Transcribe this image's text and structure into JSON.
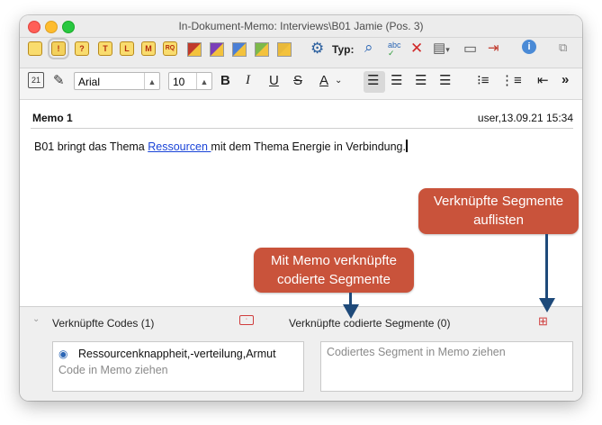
{
  "window": {
    "title": "In-Dokument-Memo: Interviews\\B01 Jamie (Pos. 3)"
  },
  "toolbar": {
    "memo_icons": [
      "",
      "!",
      "?",
      "T",
      "L",
      "M",
      "RQ"
    ],
    "type_label": "Typ:",
    "icons": [
      "search-icon",
      "spellcheck-icon",
      "delete-icon",
      "export-icon",
      "print-icon",
      "exit-icon",
      "info-icon",
      "window-icon"
    ]
  },
  "format_toolbar": {
    "font": "Arial",
    "size": "10",
    "buttons": [
      "B",
      "I",
      "U",
      "S",
      "A"
    ]
  },
  "memo": {
    "title": "Memo 1",
    "meta": "user,13.09.21 15:34",
    "text_before": "B01 bringt das Thema ",
    "link": "Ressourcen ",
    "text_after": "mit dem Thema Energie in Verbindung."
  },
  "linked_codes": {
    "label": "Verknüpfte Codes (1)",
    "item": "Ressourcenknappheit,-verteilung,Armut",
    "placeholder": "Code in Memo ziehen"
  },
  "linked_segments": {
    "label": "Verknüpfte codierte Segmente (0)",
    "placeholder": "Codiertes Segment in Memo ziehen"
  },
  "callouts": {
    "memo_segments": [
      "Mit Memo verknüpfte",
      "codierte Segmente"
    ],
    "list_segments": [
      "Verknüpfte Segmente",
      "auflisten"
    ]
  },
  "colors": {
    "callout": "#c9533b",
    "arrow": "#1e4a7a",
    "link": "#1a44d8"
  }
}
